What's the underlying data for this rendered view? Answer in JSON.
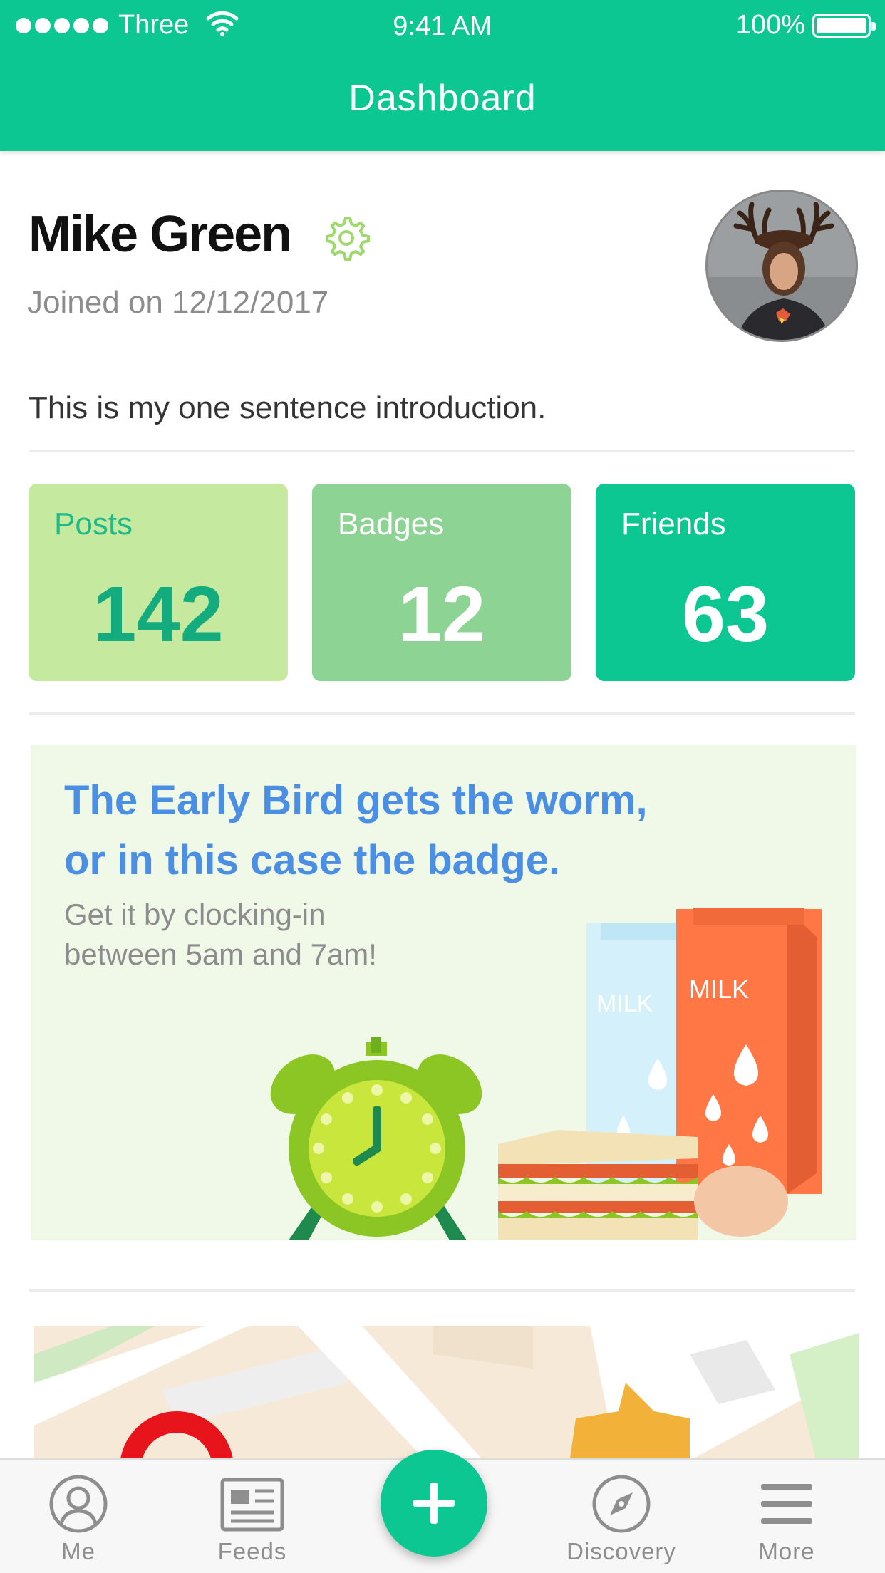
{
  "status_bar": {
    "carrier": "Three",
    "time": "9:41 AM",
    "battery": "100%"
  },
  "header": {
    "title": "Dashboard"
  },
  "profile": {
    "name": "Mike Green",
    "joined": "Joined on 12/12/2017",
    "intro": "This is my one sentence introduction."
  },
  "stats": [
    {
      "label": "Posts",
      "value": "142",
      "bg": "#c6e9a0",
      "label_color": "#1fb98a",
      "value_color": "#14ac7e"
    },
    {
      "label": "Badges",
      "value": "12",
      "bg": "#8dd494",
      "label_color": "#ffffff",
      "value_color": "#ffffff"
    },
    {
      "label": "Friends",
      "value": "63",
      "bg": "#0cc792",
      "label_color": "#ffffff",
      "value_color": "#ffffff"
    }
  ],
  "promo": {
    "title_line1": "The Early Bird gets the worm,",
    "title_line2": "or in this case the badge.",
    "subtitle_line1": "Get it by clocking-in",
    "subtitle_line2": "between 5am and 7am!",
    "milk_label_left": "MILK",
    "milk_label_right": "MILK"
  },
  "tabs": [
    {
      "label": "Me",
      "icon": "person-icon"
    },
    {
      "label": "Feeds",
      "icon": "newspaper-icon"
    },
    {
      "label": "Discovery",
      "icon": "compass-icon"
    },
    {
      "label": "More",
      "icon": "menu-icon"
    }
  ],
  "fab": {
    "icon": "plus-icon"
  },
  "colors": {
    "brand": "#0cc792",
    "promo_title": "#4a8fe3",
    "muted_text": "#8c8c8c"
  }
}
